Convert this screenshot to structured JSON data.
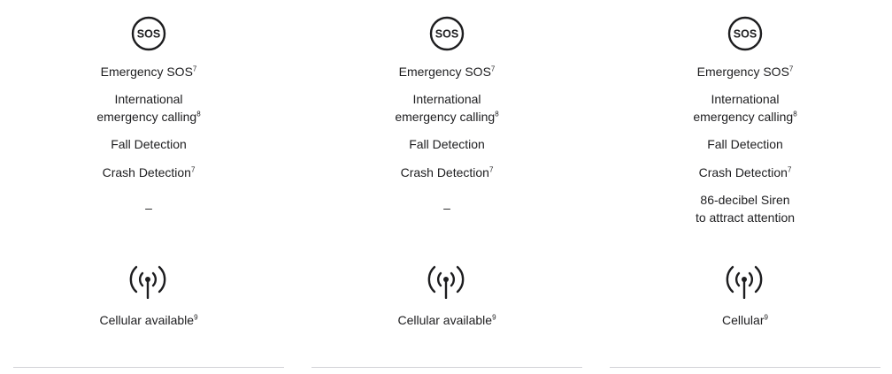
{
  "columns": [
    {
      "sos_icon_text": "SOS",
      "emergency_sos": "Emergency SOS",
      "emergency_sos_ref": "7",
      "intl_line1": "International",
      "intl_line2": "emergency calling",
      "intl_ref": "8",
      "fall_detection": "Fall Detection",
      "crash_detection": "Crash Detection",
      "crash_ref": "7",
      "siren": "–",
      "cellular": "Cellular available",
      "cellular_ref": "9"
    },
    {
      "sos_icon_text": "SOS",
      "emergency_sos": "Emergency SOS",
      "emergency_sos_ref": "7",
      "intl_line1": "International",
      "intl_line2": "emergency calling",
      "intl_ref": "8",
      "fall_detection": "Fall Detection",
      "crash_detection": "Crash Detection",
      "crash_ref": "7",
      "siren": "–",
      "cellular": "Cellular available",
      "cellular_ref": "9"
    },
    {
      "sos_icon_text": "SOS",
      "emergency_sos": "Emergency SOS",
      "emergency_sos_ref": "7",
      "intl_line1": "International",
      "intl_line2": "emergency calling",
      "intl_ref": "8",
      "fall_detection": "Fall Detection",
      "crash_detection": "Crash Detection",
      "crash_ref": "7",
      "siren_line1": "86-decibel Siren",
      "siren_line2": "to attract attention",
      "cellular": "Cellular",
      "cellular_ref": "9"
    }
  ],
  "icons": {
    "sos": "sos-icon",
    "cellular": "cellular-antenna-icon"
  },
  "colors": {
    "text": "#1d1d1f",
    "divider": "#d2d2d7"
  }
}
